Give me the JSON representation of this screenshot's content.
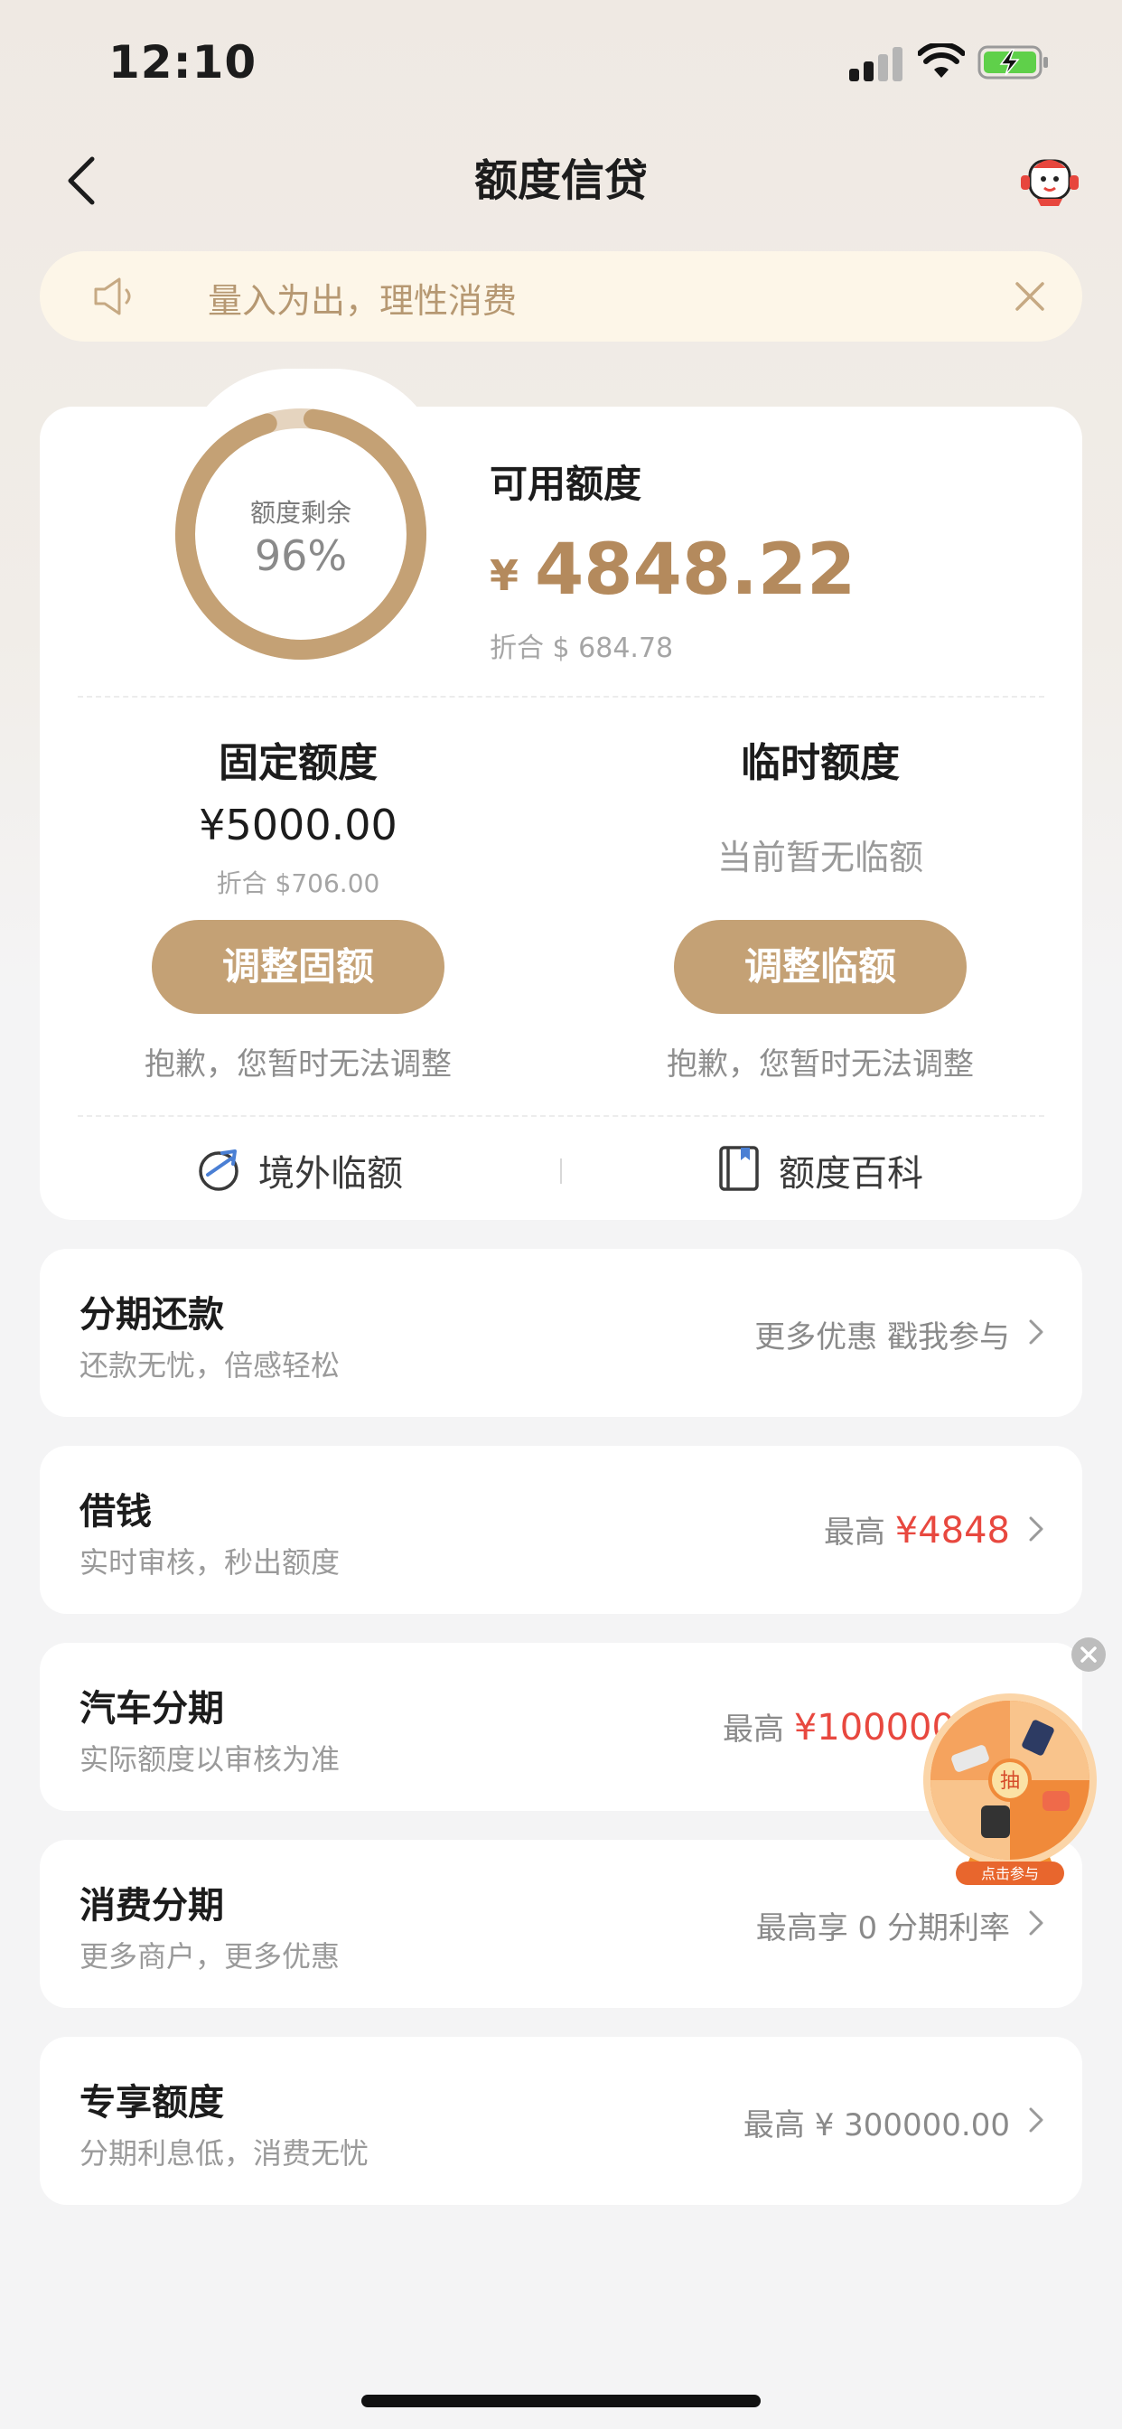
{
  "status_bar": {
    "time": "12:10"
  },
  "nav": {
    "title": "额度信贷"
  },
  "notice": {
    "text": "量入为出，理性消费"
  },
  "credit": {
    "ring_label": "额度剩余",
    "ring_percent": "96%",
    "ring_fraction": 0.96,
    "available_label": "可用额度",
    "available_currency": "¥",
    "available_value": "4848.22",
    "available_converted": "折合 $ 684.78"
  },
  "fixed": {
    "title": "固定额度",
    "amount": "¥5000.00",
    "converted": "折合 $706.00",
    "button": "调整固额",
    "note": "抱歉，您暂时无法调整"
  },
  "temporary": {
    "title": "临时额度",
    "status": "当前暂无临额",
    "button": "调整临额",
    "note": "抱歉，您暂时无法调整"
  },
  "links": {
    "overseas": "境外临额",
    "encyclopedia": "额度百科"
  },
  "rows": [
    {
      "title": "分期还款",
      "subtitle": "还款无忧，倍感轻松",
      "right": "更多优惠 戳我参与"
    },
    {
      "title": "借钱",
      "subtitle": "实时审核，秒出额度",
      "right_prefix": "最高",
      "right_value": "¥4848"
    },
    {
      "title": "汽车分期",
      "subtitle": "实际额度以审核为准",
      "right_prefix": "最高",
      "right_value": "¥100000"
    },
    {
      "title": "消费分期",
      "subtitle": "更多商户，更多优惠",
      "right": "最高享 0 分期利率"
    },
    {
      "title": "专享额度",
      "subtitle": "分期利息低，消费无忧",
      "right": "最高 ¥ 300000.00"
    }
  ],
  "float": {
    "center": "抽",
    "caption": "点击参与"
  },
  "colors": {
    "accent": "#c4a175",
    "gold_text": "#b48a5d",
    "red": "#e8483f"
  }
}
